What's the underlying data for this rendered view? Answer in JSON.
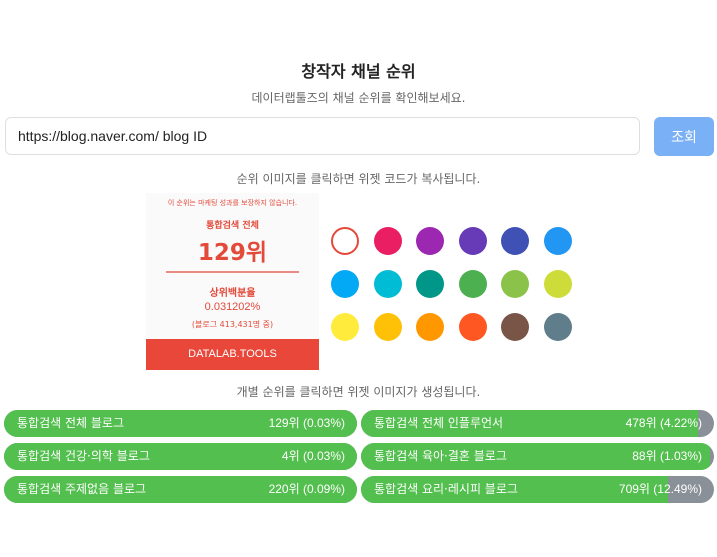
{
  "header": {
    "title": "창작자 채널 순위",
    "subtitle": "데이터랩툴즈의 채널 순위를 확인해보세요."
  },
  "search": {
    "value": "https://blog.naver.com/ blog ID",
    "button_label": "조회"
  },
  "hints": {
    "widget_copy": "순위 이미지를 클릭하면 위젯 코드가 복사됩니다.",
    "generate": "개별 순위를 클릭하면 위젯 이미지가 생성됩니다."
  },
  "widget": {
    "disclaimer": "이 순위는 마케팅 성과를 보장하지 않습니다.",
    "rank_label": "통합검색 전체",
    "rank": "129위",
    "percent_label": "상위백분율",
    "percent": "0.031202%",
    "count": "(블로그 413,431명 중)",
    "footer": "DATALAB.TOOLS"
  },
  "colors": [
    {
      "name": "red-outline",
      "hex": "#e34a3a",
      "selected": true
    },
    {
      "name": "pink",
      "hex": "#e91e63"
    },
    {
      "name": "purple",
      "hex": "#9c27b0"
    },
    {
      "name": "deep-purple",
      "hex": "#673ab7"
    },
    {
      "name": "indigo",
      "hex": "#3f51b5"
    },
    {
      "name": "blue",
      "hex": "#2196f3"
    },
    {
      "name": "light-blue",
      "hex": "#03a9f4"
    },
    {
      "name": "cyan",
      "hex": "#00bcd4"
    },
    {
      "name": "teal",
      "hex": "#009688"
    },
    {
      "name": "green",
      "hex": "#4caf50"
    },
    {
      "name": "light-green",
      "hex": "#8bc34a"
    },
    {
      "name": "lime",
      "hex": "#cddc39"
    },
    {
      "name": "yellow",
      "hex": "#ffeb3b"
    },
    {
      "name": "amber",
      "hex": "#ffc107"
    },
    {
      "name": "orange",
      "hex": "#ff9800"
    },
    {
      "name": "deep-orange",
      "hex": "#ff5722"
    },
    {
      "name": "brown",
      "hex": "#795548"
    },
    {
      "name": "blue-grey",
      "hex": "#607d8b"
    }
  ],
  "rankings": [
    {
      "name": "통합검색 전체 블로그",
      "value": "129위 (0.03%)",
      "fill": 1.0
    },
    {
      "name": "통합검색 전체 인플루언서",
      "value": "478위 (4.22%)",
      "fill": 0.955
    },
    {
      "name": "통합검색 건강·의학 블로그",
      "value": "4위 (0.03%)",
      "fill": 1.0
    },
    {
      "name": "통합검색 육아·결혼 블로그",
      "value": "88위 (1.03%)",
      "fill": 0.99
    },
    {
      "name": "통합검색 주제없음 블로그",
      "value": "220위 (0.09%)",
      "fill": 1.0
    },
    {
      "name": "통합검색 요리·레시피 블로그",
      "value": "709위 (12.49%)",
      "fill": 0.87
    }
  ]
}
